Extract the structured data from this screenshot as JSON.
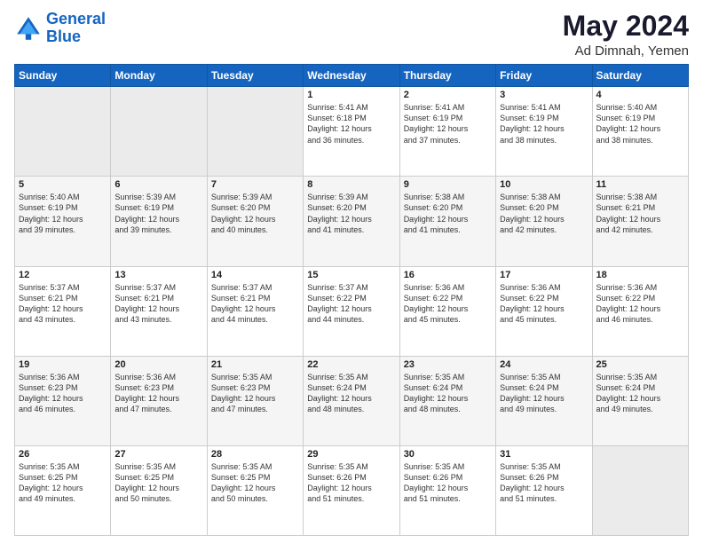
{
  "header": {
    "logo_line1": "General",
    "logo_line2": "Blue",
    "title": "May 2024",
    "subtitle": "Ad Dimnah, Yemen"
  },
  "weekdays": [
    "Sunday",
    "Monday",
    "Tuesday",
    "Wednesday",
    "Thursday",
    "Friday",
    "Saturday"
  ],
  "weeks": [
    [
      {
        "day": "",
        "info": ""
      },
      {
        "day": "",
        "info": ""
      },
      {
        "day": "",
        "info": ""
      },
      {
        "day": "1",
        "info": "Sunrise: 5:41 AM\nSunset: 6:18 PM\nDaylight: 12 hours\nand 36 minutes."
      },
      {
        "day": "2",
        "info": "Sunrise: 5:41 AM\nSunset: 6:19 PM\nDaylight: 12 hours\nand 37 minutes."
      },
      {
        "day": "3",
        "info": "Sunrise: 5:41 AM\nSunset: 6:19 PM\nDaylight: 12 hours\nand 38 minutes."
      },
      {
        "day": "4",
        "info": "Sunrise: 5:40 AM\nSunset: 6:19 PM\nDaylight: 12 hours\nand 38 minutes."
      }
    ],
    [
      {
        "day": "5",
        "info": "Sunrise: 5:40 AM\nSunset: 6:19 PM\nDaylight: 12 hours\nand 39 minutes."
      },
      {
        "day": "6",
        "info": "Sunrise: 5:39 AM\nSunset: 6:19 PM\nDaylight: 12 hours\nand 39 minutes."
      },
      {
        "day": "7",
        "info": "Sunrise: 5:39 AM\nSunset: 6:20 PM\nDaylight: 12 hours\nand 40 minutes."
      },
      {
        "day": "8",
        "info": "Sunrise: 5:39 AM\nSunset: 6:20 PM\nDaylight: 12 hours\nand 41 minutes."
      },
      {
        "day": "9",
        "info": "Sunrise: 5:38 AM\nSunset: 6:20 PM\nDaylight: 12 hours\nand 41 minutes."
      },
      {
        "day": "10",
        "info": "Sunrise: 5:38 AM\nSunset: 6:20 PM\nDaylight: 12 hours\nand 42 minutes."
      },
      {
        "day": "11",
        "info": "Sunrise: 5:38 AM\nSunset: 6:21 PM\nDaylight: 12 hours\nand 42 minutes."
      }
    ],
    [
      {
        "day": "12",
        "info": "Sunrise: 5:37 AM\nSunset: 6:21 PM\nDaylight: 12 hours\nand 43 minutes."
      },
      {
        "day": "13",
        "info": "Sunrise: 5:37 AM\nSunset: 6:21 PM\nDaylight: 12 hours\nand 43 minutes."
      },
      {
        "day": "14",
        "info": "Sunrise: 5:37 AM\nSunset: 6:21 PM\nDaylight: 12 hours\nand 44 minutes."
      },
      {
        "day": "15",
        "info": "Sunrise: 5:37 AM\nSunset: 6:22 PM\nDaylight: 12 hours\nand 44 minutes."
      },
      {
        "day": "16",
        "info": "Sunrise: 5:36 AM\nSunset: 6:22 PM\nDaylight: 12 hours\nand 45 minutes."
      },
      {
        "day": "17",
        "info": "Sunrise: 5:36 AM\nSunset: 6:22 PM\nDaylight: 12 hours\nand 45 minutes."
      },
      {
        "day": "18",
        "info": "Sunrise: 5:36 AM\nSunset: 6:22 PM\nDaylight: 12 hours\nand 46 minutes."
      }
    ],
    [
      {
        "day": "19",
        "info": "Sunrise: 5:36 AM\nSunset: 6:23 PM\nDaylight: 12 hours\nand 46 minutes."
      },
      {
        "day": "20",
        "info": "Sunrise: 5:36 AM\nSunset: 6:23 PM\nDaylight: 12 hours\nand 47 minutes."
      },
      {
        "day": "21",
        "info": "Sunrise: 5:35 AM\nSunset: 6:23 PM\nDaylight: 12 hours\nand 47 minutes."
      },
      {
        "day": "22",
        "info": "Sunrise: 5:35 AM\nSunset: 6:24 PM\nDaylight: 12 hours\nand 48 minutes."
      },
      {
        "day": "23",
        "info": "Sunrise: 5:35 AM\nSunset: 6:24 PM\nDaylight: 12 hours\nand 48 minutes."
      },
      {
        "day": "24",
        "info": "Sunrise: 5:35 AM\nSunset: 6:24 PM\nDaylight: 12 hours\nand 49 minutes."
      },
      {
        "day": "25",
        "info": "Sunrise: 5:35 AM\nSunset: 6:24 PM\nDaylight: 12 hours\nand 49 minutes."
      }
    ],
    [
      {
        "day": "26",
        "info": "Sunrise: 5:35 AM\nSunset: 6:25 PM\nDaylight: 12 hours\nand 49 minutes."
      },
      {
        "day": "27",
        "info": "Sunrise: 5:35 AM\nSunset: 6:25 PM\nDaylight: 12 hours\nand 50 minutes."
      },
      {
        "day": "28",
        "info": "Sunrise: 5:35 AM\nSunset: 6:25 PM\nDaylight: 12 hours\nand 50 minutes."
      },
      {
        "day": "29",
        "info": "Sunrise: 5:35 AM\nSunset: 6:26 PM\nDaylight: 12 hours\nand 51 minutes."
      },
      {
        "day": "30",
        "info": "Sunrise: 5:35 AM\nSunset: 6:26 PM\nDaylight: 12 hours\nand 51 minutes."
      },
      {
        "day": "31",
        "info": "Sunrise: 5:35 AM\nSunset: 6:26 PM\nDaylight: 12 hours\nand 51 minutes."
      },
      {
        "day": "",
        "info": ""
      }
    ]
  ]
}
